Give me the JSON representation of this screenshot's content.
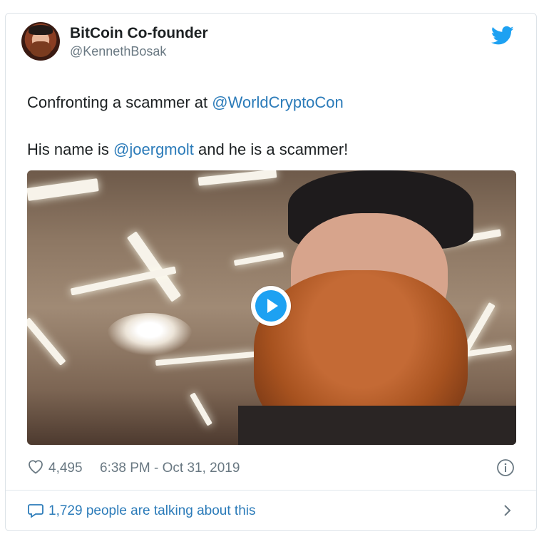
{
  "author": {
    "display_name": "BitCoin Co-founder",
    "handle": "@KennethBosak",
    "avatar_icon": "user-avatar"
  },
  "brand_icon": "twitter-bird-icon",
  "brand_color": "#1da1f2",
  "tweet": {
    "line1_prefix": "Confronting a scammer at ",
    "line1_mention": "@WorldCryptoCon",
    "line2_prefix": "His name is ",
    "line2_mention": "@joergmolt",
    "line2_suffix": " and he is a scammer!"
  },
  "media": {
    "type": "video",
    "play_icon": "play-icon"
  },
  "meta": {
    "likes": "4,495",
    "timestamp": "6:38 PM - Oct 31, 2019",
    "like_icon": "heart-icon",
    "info_icon": "info-icon"
  },
  "footer": {
    "conversation_text": "1,729 people are talking about this",
    "icon": "speech-bubble-icon",
    "chevron_icon": "chevron-right-icon"
  },
  "colors": {
    "link": "#2b7bb9",
    "text": "#1c2022",
    "muted": "#697882",
    "border": "#dde3e8"
  }
}
